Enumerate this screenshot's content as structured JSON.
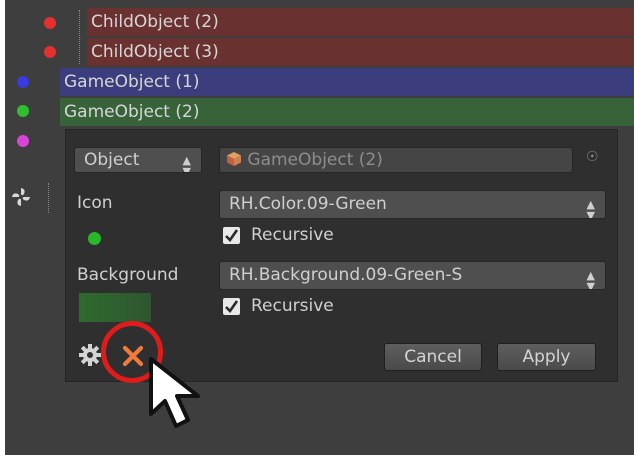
{
  "hierarchy": {
    "rows": [
      {
        "label": "ChildObject (2)",
        "dot_color": "#e53030",
        "band_color": "#6a3131"
      },
      {
        "label": "ChildObject (3)",
        "dot_color": "#e53030",
        "band_color": "#6a3131"
      },
      {
        "label": "GameObject (1)",
        "dot_color": "#3a3ae0",
        "band_color": "#3b3d7d"
      },
      {
        "label": "GameObject (2)",
        "dot_color": "#2fbf2f",
        "band_color": "#38633a"
      }
    ],
    "extra_dot_color": "#d645d6",
    "gear_icon": "fan-icon"
  },
  "panel": {
    "type_select": {
      "value": "Object"
    },
    "object_field": {
      "value": "GameObject (2)",
      "icon": "cube-icon"
    },
    "icon_label": "Icon",
    "icon_select": {
      "value": "RH.Color.09-Green"
    },
    "icon_preview_color": "#29b829",
    "icon_recursive": {
      "label": "Recursive",
      "checked": true
    },
    "background_label": "Background",
    "background_select": {
      "value": "RH.Background.09-Green-S"
    },
    "background_preview_color": "#2e6b2e",
    "background_recursive": {
      "label": "Recursive",
      "checked": true
    },
    "settings_icon": "gear-icon",
    "remove_icon": "close-icon",
    "cancel_label": "Cancel",
    "apply_label": "Apply"
  },
  "colors": {
    "highlight_ring": "#e01b1b",
    "remove_x": "#f07a3c"
  }
}
